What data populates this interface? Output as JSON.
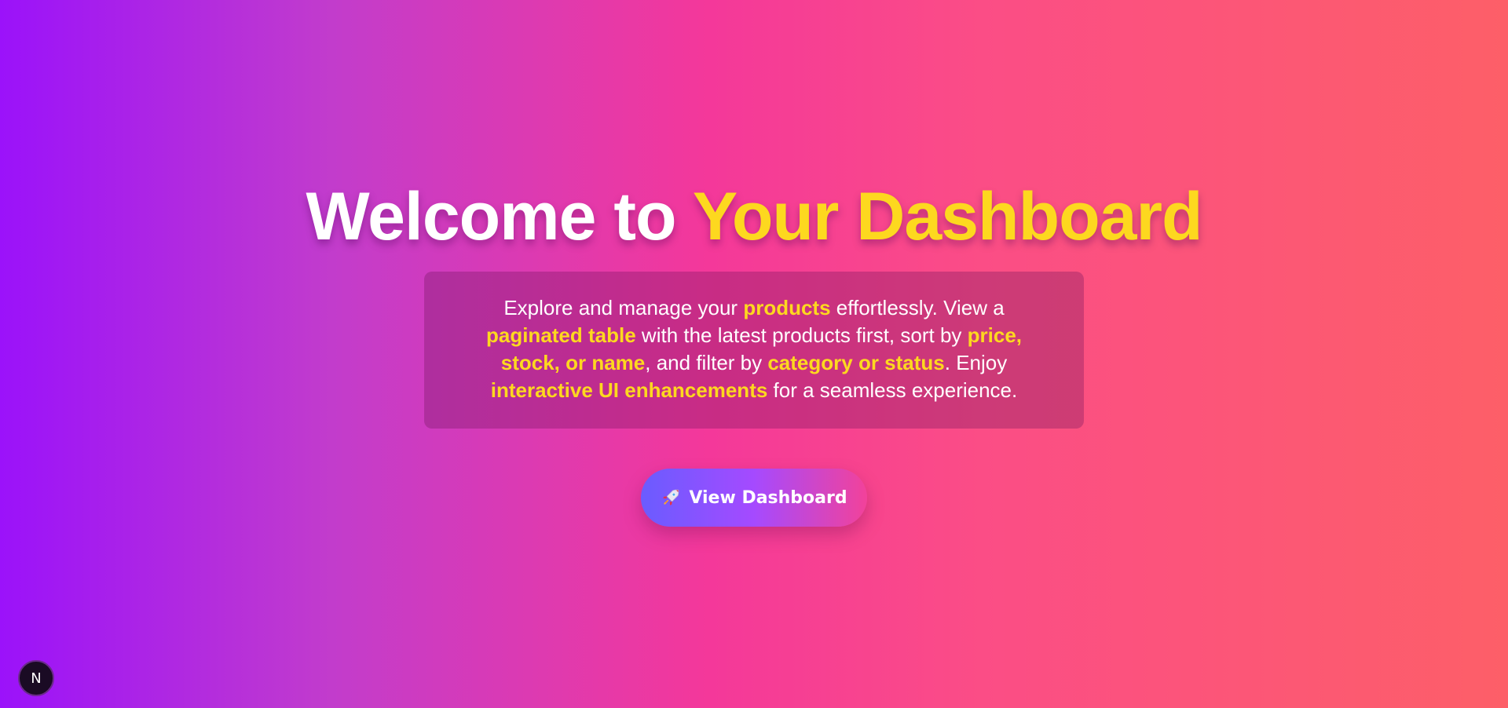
{
  "hero": {
    "title_prefix": "Welcome to",
    "title_accent": "Your Dashboard",
    "description": {
      "t1": "Explore and manage your ",
      "h1": "products",
      "t2": " effortlessly. View a ",
      "h2": "paginated table",
      "t3": " with the latest products first, sort by ",
      "h3": "price, stock, or name",
      "t4": ", and filter by ",
      "h4": "category or status",
      "t5": ". Enjoy ",
      "h5": "interactive UI enhancements",
      "t6": " for a seamless experience."
    },
    "cta_label": "View Dashboard",
    "cta_icon": "rocket-icon"
  },
  "dev_badge": {
    "label": "N",
    "icon": "nextjs-icon"
  },
  "colors": {
    "accent": "#fdd81f",
    "gradient_start": "#9b12fa",
    "gradient_mid": "#f4389a",
    "gradient_end": "#fd5f68"
  }
}
